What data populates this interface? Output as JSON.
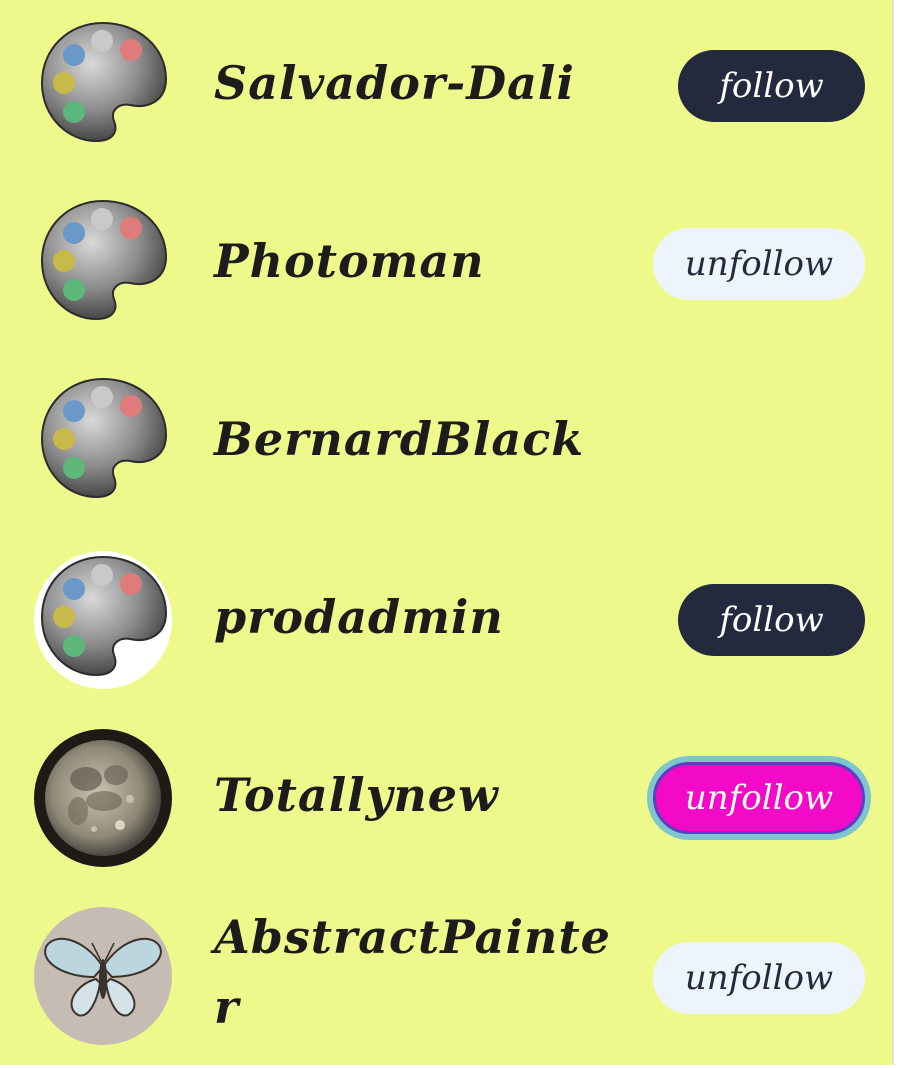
{
  "users": [
    {
      "name": "Salvador-Dali",
      "avatar": "palette-icon",
      "button": "follow"
    },
    {
      "name": "Photoman",
      "avatar": "palette-icon",
      "button": "unfollow"
    },
    {
      "name": "BernardBlack",
      "avatar": "palette-icon",
      "button": ""
    },
    {
      "name": "prodadmin",
      "avatar": "palette-icon",
      "button": "follow"
    },
    {
      "name": "Totallynew",
      "avatar": "moon-photo",
      "button": "unfollow"
    },
    {
      "name": "AbstractPainte",
      "name_wrap": "r",
      "avatar": "butterfly-drawing",
      "button": "unfollow"
    }
  ],
  "colors": {
    "background": "#eef98c",
    "follow_button": "#232a3e",
    "unfollow_button": "#eef4fb",
    "unfollow_active": "#f20ac8",
    "focus_ring": "#7ec6cf"
  }
}
